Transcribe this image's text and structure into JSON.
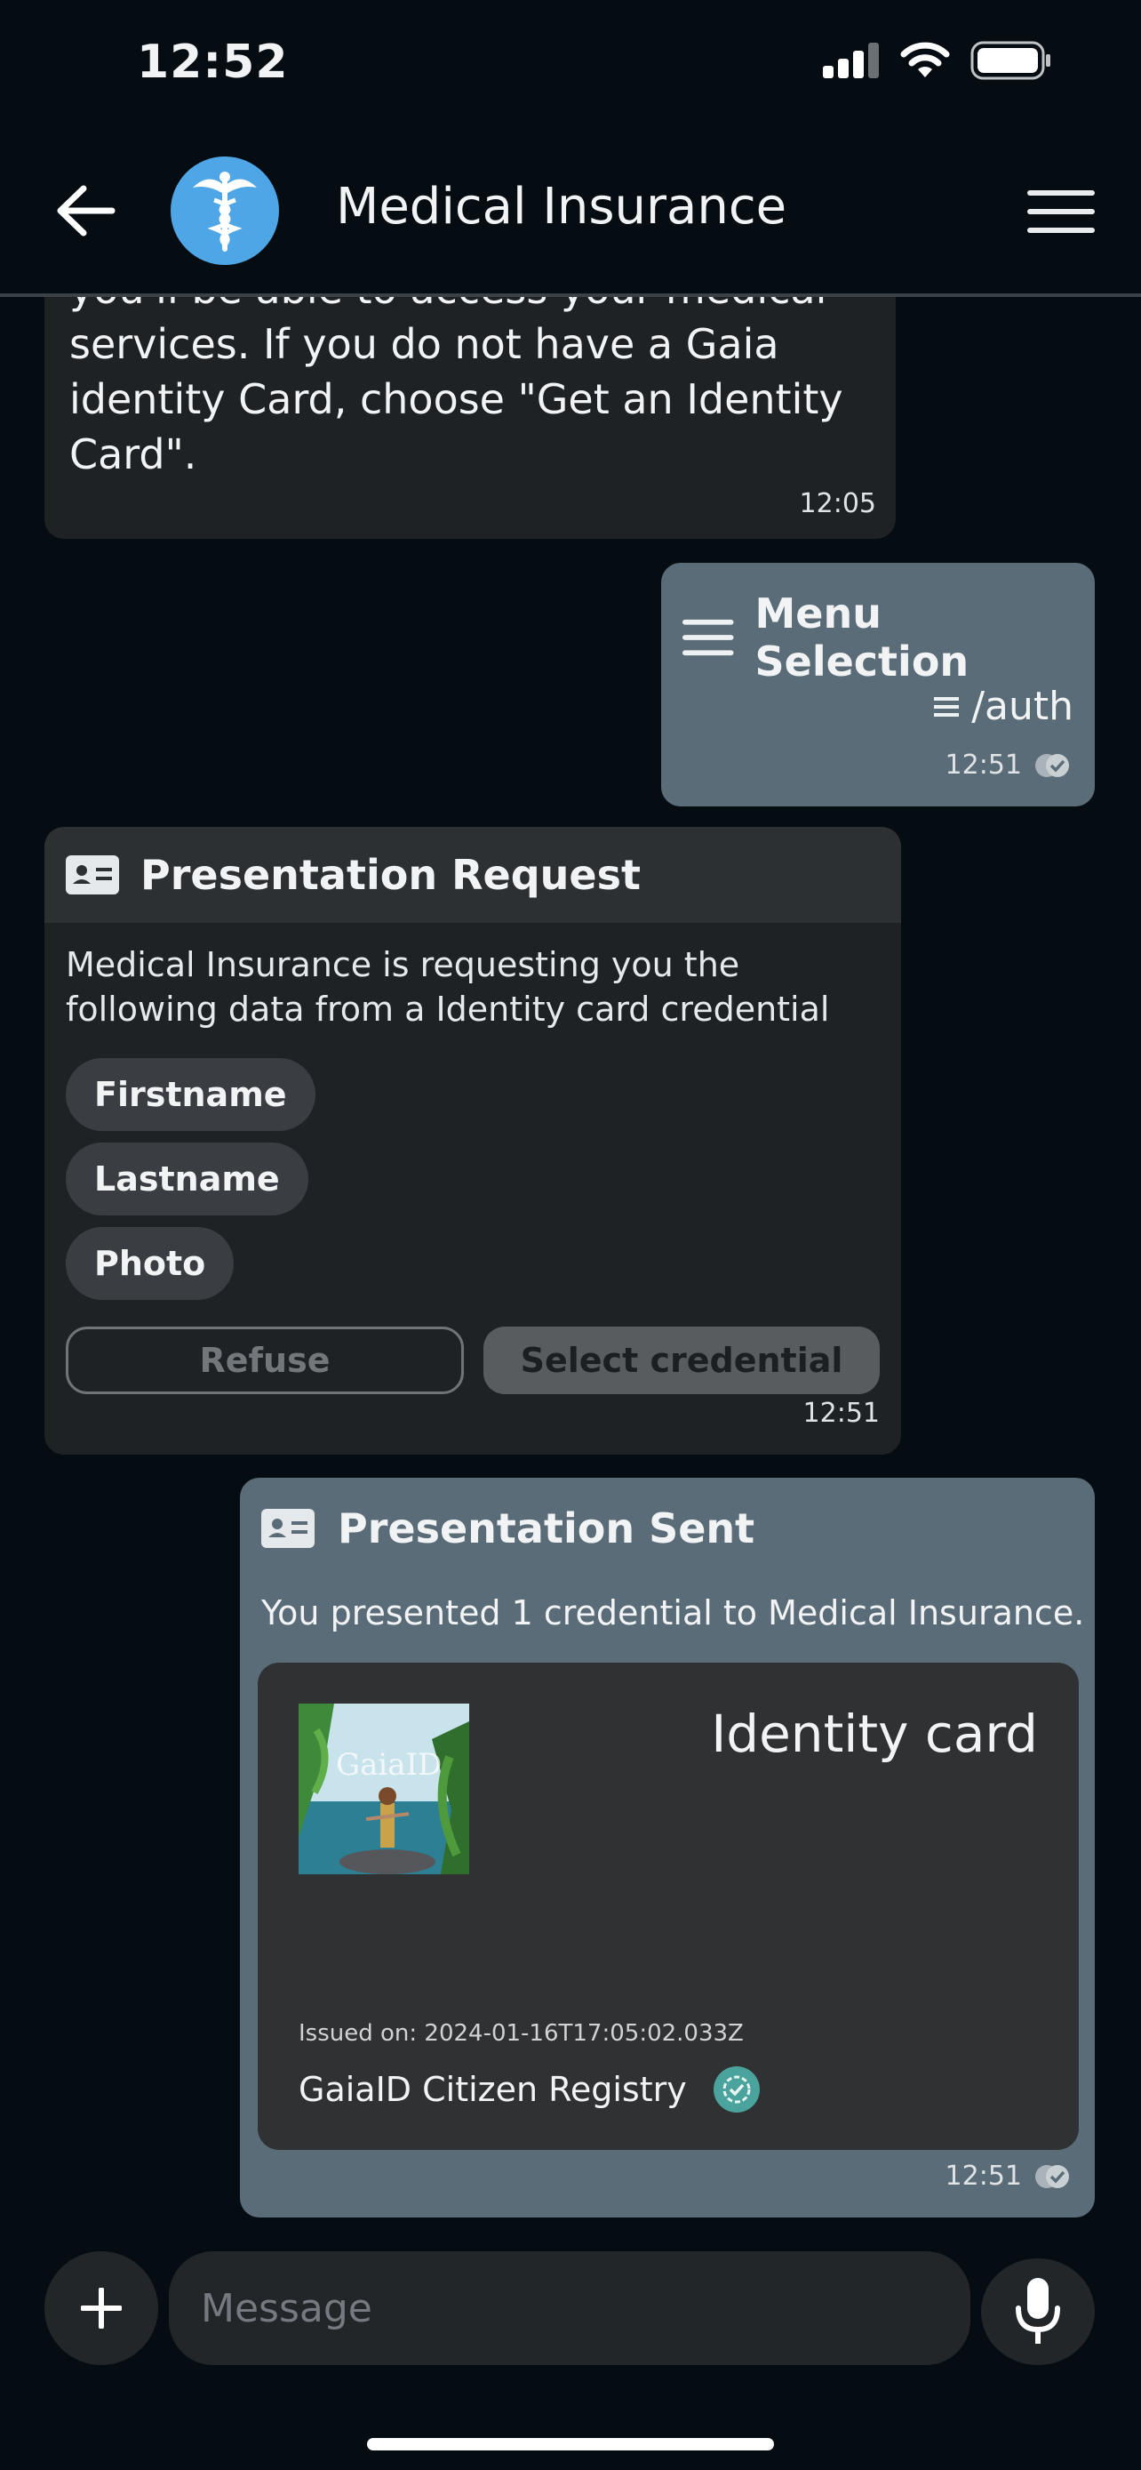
{
  "status_bar": {
    "time": "12:52"
  },
  "header": {
    "title": "Medical Insurance"
  },
  "messages": {
    "intro": {
      "text": "you'll be able to access your medical services. If you do not have a Gaia identity Card, choose \"Get an Identity Card\".",
      "time": "12:05"
    },
    "menu_selection": {
      "title": "Menu Selection",
      "command": "/auth",
      "time": "12:51"
    },
    "presentation_request": {
      "title": "Presentation Request",
      "body": "Medical Insurance is requesting you the following data from a Identity card credential",
      "attributes": [
        "Firstname",
        "Lastname",
        "Photo"
      ],
      "refuse_label": "Refuse",
      "select_label": "Select credential",
      "time": "12:51"
    },
    "presentation_sent": {
      "title": "Presentation Sent",
      "body": "You presented 1 credential to Medical Insurance.",
      "credential": {
        "name": "Identity card",
        "image_text": "GaiaID",
        "issued": "Issued on: 2024-01-16T17:05:02.033Z",
        "issuer": "GaiaID Citizen Registry"
      },
      "time": "12:51"
    }
  },
  "composer": {
    "placeholder": "Message"
  },
  "colors": {
    "accent": "#4fa6e6",
    "outgoing": "#5a6c77",
    "incoming": "#1f2225",
    "verified": "#4aa39c"
  }
}
